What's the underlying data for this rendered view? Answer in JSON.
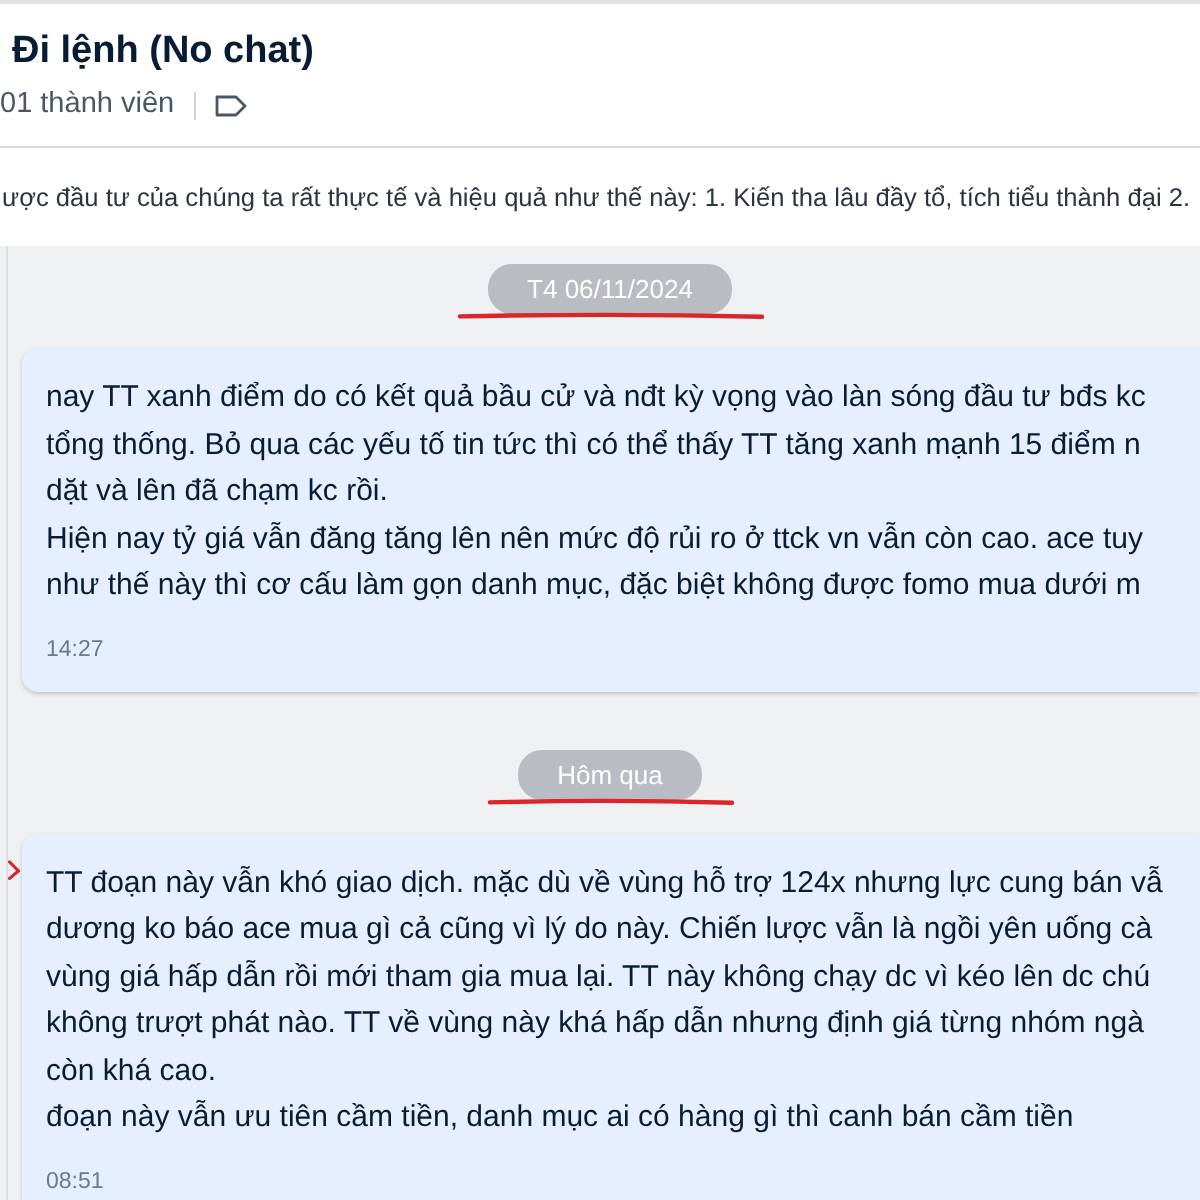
{
  "header": {
    "title": "Đi lệnh (No chat)",
    "members": "01 thành viên"
  },
  "pinned_message": {
    "text": "ược đầu tư của chúng ta rất thực tế và hiệu quả như thế này:  1. Kiến tha lâu đầy tổ, tích tiểu thành đại 2."
  },
  "timeline": [
    {
      "kind": "date",
      "label": "T4 06/11/2024",
      "underlined": true
    },
    {
      "kind": "message",
      "marked": false,
      "lines": [
        "nay TT xanh điểm do có kết quả bầu cử và nđt kỳ vọng vào làn sóng đầu tư bđs kc",
        "tổng thống. Bỏ qua các yếu tố tin tức thì có thể thấy TT tăng xanh mạnh 15 điểm n",
        "dặt và lên đã chạm kc rồi.",
        "Hiện nay tỷ giá vẫn đăng tăng lên nên mức độ rủi ro ở ttck vn vẫn còn cao. ace tuy",
        "như thế này thì cơ cấu làm gọn danh mục, đặc biệt không được fomo mua dưới m"
      ],
      "time": "14:27"
    },
    {
      "kind": "date",
      "label": "Hôm qua",
      "underlined": true
    },
    {
      "kind": "message",
      "marked": true,
      "lines": [
        "TT đoạn này vẫn khó giao dịch. mặc dù về vùng hỗ trợ 124x nhưng lực cung bán vẫ",
        "dương ko báo ace mua gì cả cũng vì lý do này. Chiến lược vẫn là ngồi yên uống cà",
        "vùng giá hấp dẫn rồi mới tham gia mua lại. TT này không chạy dc vì kéo lên dc chú",
        "không trượt phát nào. TT về vùng này khá hấp dẫn nhưng định giá từng nhóm ngà",
        "còn khá cao.",
        "đoạn này vẫn ưu tiên cầm tiền, danh mục ai có hàng gì thì canh bán cầm tiền"
      ],
      "time": "08:51"
    }
  ]
}
